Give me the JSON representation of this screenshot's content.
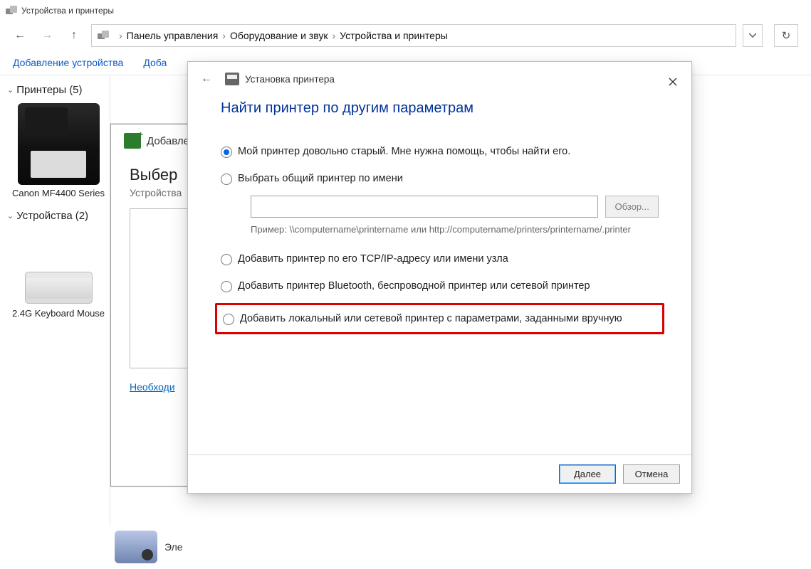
{
  "window": {
    "title": "Устройства и принтеры"
  },
  "nav": {
    "crumbs": [
      "Панель управления",
      "Оборудование и звук",
      "Устройства и принтеры"
    ]
  },
  "cmdbar": {
    "add_device": "Добавление устройства",
    "add_truncated": "Доба"
  },
  "sidebar": {
    "printers_label": "Принтеры",
    "printers_count": "(5)",
    "devices_label": "Устройства",
    "devices_count": "(2)",
    "items": [
      {
        "name": "Canon MF4400 Series"
      },
      {
        "name": "2.4G Keyboard Mouse"
      }
    ]
  },
  "inner_panel": {
    "header": "Добавление",
    "title_trunc": "Выбер",
    "subtitle_trunc": "Устройства",
    "link_trunc": "Необходи"
  },
  "status_trunc": "Эле",
  "wizard": {
    "title": "Установка принтера",
    "heading": "Найти принтер по другим параметрам",
    "options": {
      "old": "Мой принтер довольно старый. Мне нужна помощь, чтобы найти его.",
      "by_name": "Выбрать общий принтер по имени",
      "browse": "Обзор...",
      "example": "Пример: \\\\computername\\printername или http://computername/printers/printername/.printer",
      "tcp": "Добавить принтер по его TCP/IP-адресу или имени узла",
      "bt": "Добавить принтер Bluetooth, беспроводной принтер или сетевой принтер",
      "manual": "Добавить локальный или сетевой принтер с параметрами, заданными вручную"
    },
    "buttons": {
      "next": "Далее",
      "cancel": "Отмена"
    }
  }
}
